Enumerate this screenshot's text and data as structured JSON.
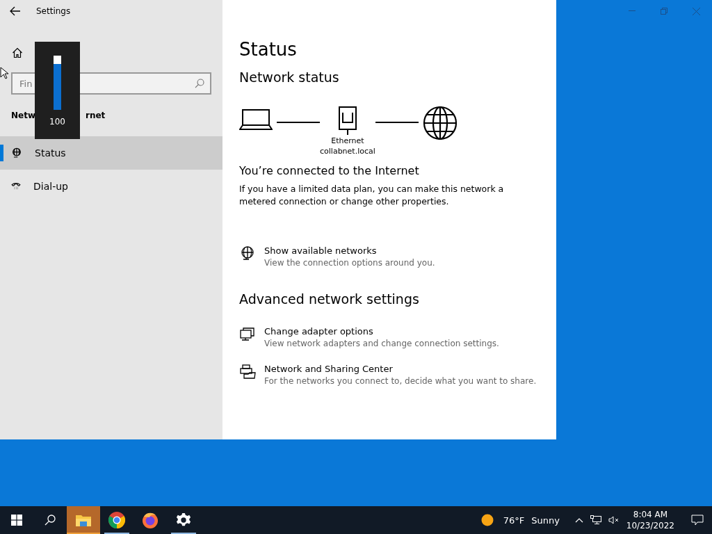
{
  "window": {
    "title": "Settings"
  },
  "sidebar": {
    "search": {
      "placeholder": "Fin"
    },
    "heading_parts": [
      "Netw",
      "rnet"
    ],
    "items": [
      {
        "label": "Status",
        "kind": "status",
        "selected": true
      },
      {
        "label": "Dial-up",
        "kind": "dialup",
        "selected": false
      }
    ]
  },
  "volume_flyout": {
    "level": 0.85,
    "reading": "100"
  },
  "main": {
    "title": "Status",
    "section": "Network status",
    "diagram": {
      "adapter": "Ethernet",
      "domain": "collabnet.local"
    },
    "connection": {
      "heading": "You’re connected to the Internet",
      "description": "If you have a limited data plan, you can make this network a metered connection or change other properties."
    },
    "links": [
      {
        "kind": "globe",
        "title": "Show available networks",
        "subtitle": "View the connection options around you."
      }
    ],
    "advanced": {
      "heading": "Advanced network settings",
      "links": [
        {
          "kind": "monitors",
          "title": "Change adapter options",
          "subtitle": "View network adapters and change connection settings."
        },
        {
          "kind": "sharing",
          "title": "Network and Sharing Center",
          "subtitle": "For the networks you connect to, decide what you want to share."
        }
      ]
    }
  },
  "taskbar": {
    "apps": [
      {
        "kind": "explorer",
        "active": true,
        "running": true
      },
      {
        "kind": "chrome",
        "active": false,
        "running": true
      },
      {
        "kind": "firefox",
        "active": false,
        "running": false
      },
      {
        "kind": "settings",
        "active": false,
        "running": true
      }
    ],
    "weather": {
      "temperature": "76°F",
      "condition": "Sunny"
    },
    "time": "8:04 AM",
    "date": "10/23/2022"
  }
}
